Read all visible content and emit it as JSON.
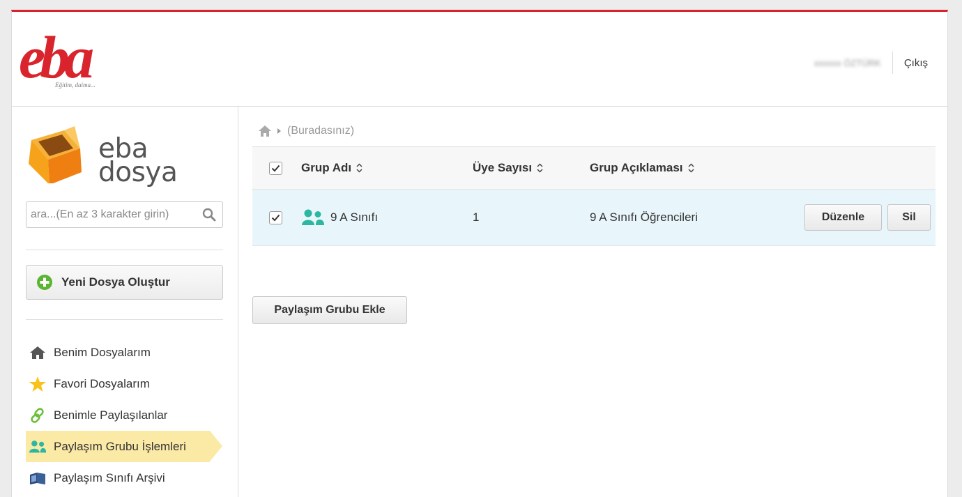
{
  "header": {
    "logo_tagline": "Eğitim, daima...",
    "user_name": "xxxxxx ÖZTÜRK",
    "logout_label": "Çıkış"
  },
  "sidebar": {
    "brand_line1": "eba",
    "brand_line2": "dosya",
    "search_placeholder": "ara...(En az 3 karakter girin)",
    "new_file_label": "Yeni Dosya Oluştur",
    "nav": [
      {
        "label": "Benim Dosyalarım",
        "icon": "home-icon"
      },
      {
        "label": "Favori Dosyalarım",
        "icon": "star-icon"
      },
      {
        "label": "Benimle Paylaşılanlar",
        "icon": "link-icon"
      },
      {
        "label": "Paylaşım Grubu İşlemleri",
        "icon": "group-icon",
        "active": true
      },
      {
        "label": "Paylaşım Sınıfı Arşivi",
        "icon": "archive-icon"
      }
    ]
  },
  "main": {
    "breadcrumb": "(Buradasınız)",
    "table": {
      "columns": [
        "Grup Adı",
        "Üye Sayısı",
        "Grup Açıklaması"
      ],
      "rows": [
        {
          "name": "9 A Sınıfı",
          "members": "1",
          "description": "9 A Sınıfı Öğrencileri",
          "edit_label": "Düzenle",
          "delete_label": "Sil"
        }
      ]
    },
    "add_group_label": "Paylaşım Grubu Ekle"
  },
  "colors": {
    "brand_red": "#d9232d",
    "active_nav": "#fbe9a6",
    "row_highlight": "#e8f6fb",
    "group_icon": "#2bb7a0"
  }
}
